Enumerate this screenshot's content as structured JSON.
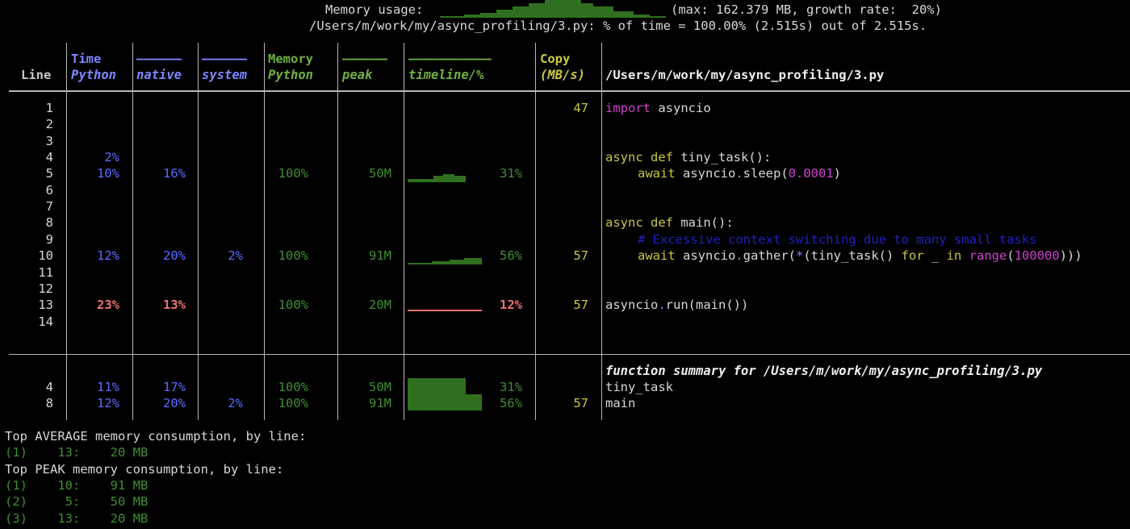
{
  "header": {
    "memory_label": "Memory usage:",
    "memory_stats": "(max: 162.379 MB, growth rate:  20%)",
    "file_summary": "/Users/m/work/my/async_profiling/3.py: % of time = 100.00% (2.515s) out of 2.515s."
  },
  "columns": {
    "line": "Line",
    "time_top": "Time",
    "time_bottom": "Python",
    "native_top": "––––––",
    "native_bottom": "native",
    "system_top": "––––––",
    "system_bottom": "system",
    "memory_top": "Memory",
    "memory_bottom": "Python",
    "peak_top": "––––––",
    "peak_bottom": "peak",
    "timeline_top": "–––––––––––",
    "timeline_bottom": "timeline/%",
    "copy_top": "Copy",
    "copy_bottom": "(MB/s)",
    "file": "/Users/m/work/my/async_profiling/3.py"
  },
  "rows": [
    {
      "line": "1",
      "python": "",
      "native": "",
      "system": "",
      "memory": "",
      "peak": "",
      "timeline_pct": "",
      "copy": "47"
    },
    {
      "line": "2",
      "python": "",
      "native": "",
      "system": "",
      "memory": "",
      "peak": "",
      "timeline_pct": "",
      "copy": ""
    },
    {
      "line": "3",
      "python": "",
      "native": "",
      "system": "",
      "memory": "",
      "peak": "",
      "timeline_pct": "",
      "copy": ""
    },
    {
      "line": "4",
      "python": "2%",
      "native": "",
      "system": "",
      "memory": "",
      "peak": "",
      "timeline_pct": "",
      "copy": ""
    },
    {
      "line": "5",
      "python": "10%",
      "native": "16%",
      "system": "",
      "memory": "100%",
      "peak": "50M",
      "timeline_pct": "31%",
      "copy": ""
    },
    {
      "line": "6",
      "python": "",
      "native": "",
      "system": "",
      "memory": "",
      "peak": "",
      "timeline_pct": "",
      "copy": ""
    },
    {
      "line": "7",
      "python": "",
      "native": "",
      "system": "",
      "memory": "",
      "peak": "",
      "timeline_pct": "",
      "copy": ""
    },
    {
      "line": "8",
      "python": "",
      "native": "",
      "system": "",
      "memory": "",
      "peak": "",
      "timeline_pct": "",
      "copy": ""
    },
    {
      "line": "9",
      "python": "",
      "native": "",
      "system": "",
      "memory": "",
      "peak": "",
      "timeline_pct": "",
      "copy": ""
    },
    {
      "line": "10",
      "python": "12%",
      "native": "20%",
      "system": "2%",
      "memory": "100%",
      "peak": "91M",
      "timeline_pct": "56%",
      "copy": "57"
    },
    {
      "line": "11",
      "python": "",
      "native": "",
      "system": "",
      "memory": "",
      "peak": "",
      "timeline_pct": "",
      "copy": ""
    },
    {
      "line": "12",
      "python": "",
      "native": "",
      "system": "",
      "memory": "",
      "peak": "",
      "timeline_pct": "",
      "copy": ""
    },
    {
      "line": "13",
      "python": "23%",
      "native": "13%",
      "system": "",
      "memory": "100%",
      "peak": "20M",
      "timeline_pct": "12%",
      "copy": "57"
    },
    {
      "line": "14",
      "python": "",
      "native": "",
      "system": "",
      "memory": "",
      "peak": "",
      "timeline_pct": "",
      "copy": ""
    }
  ],
  "code": {
    "l1_kw": "import",
    "l1_rest": " asyncio",
    "l4_kw": "async def",
    "l4_rest": " tiny_task():",
    "l5_kw": "await",
    "l5_a": " asyncio",
    "l5_dot": ".",
    "l5_b": "sleep(",
    "l5_num": "0.0001",
    "l5_c": ")",
    "l8_kw": "async def",
    "l8_rest": " main():",
    "l9_comment": "# Excessive context switching due to many small tasks",
    "l10_kw": "await",
    "l10_a": " asyncio",
    "l10_dot": ".",
    "l10_b": "gather(",
    "l10_star": "*",
    "l10_c": "(tiny_task() ",
    "l10_for": "for",
    "l10_d": " _ ",
    "l10_in": "in",
    "l10_e": " ",
    "l10_range": "range",
    "l10_f": "(",
    "l10_num": "100000",
    "l10_g": ")))",
    "l13_a": "asyncio",
    "l13_dot": ".",
    "l13_b": "run(main())"
  },
  "summary": {
    "title": "function summary for /Users/m/work/my/async_profiling/3.py",
    "rows": [
      {
        "line": "4",
        "python": "11%",
        "native": "17%",
        "system": "",
        "memory": "100%",
        "peak": "50M",
        "timeline_pct": "31%",
        "copy": "",
        "name": "tiny_task"
      },
      {
        "line": "8",
        "python": "12%",
        "native": "20%",
        "system": "2%",
        "memory": "100%",
        "peak": "91M",
        "timeline_pct": "56%",
        "copy": "57",
        "name": "main"
      }
    ]
  },
  "footer": {
    "avg_title": "Top AVERAGE memory consumption, by line:",
    "avg_items": [
      "(1)    13:    20 MB"
    ],
    "peak_title": "Top PEAK memory consumption, by line:",
    "peak_items": [
      "(1)    10:    91 MB",
      "(2)     5:    50 MB",
      "(3)    13:    20 MB"
    ]
  },
  "colors": {
    "background": "#000000",
    "time_blue": "#5b6cff",
    "memory_green": "#3f8f2f",
    "copy_yellow": "#c8c840",
    "hot_red": "#f07070"
  }
}
